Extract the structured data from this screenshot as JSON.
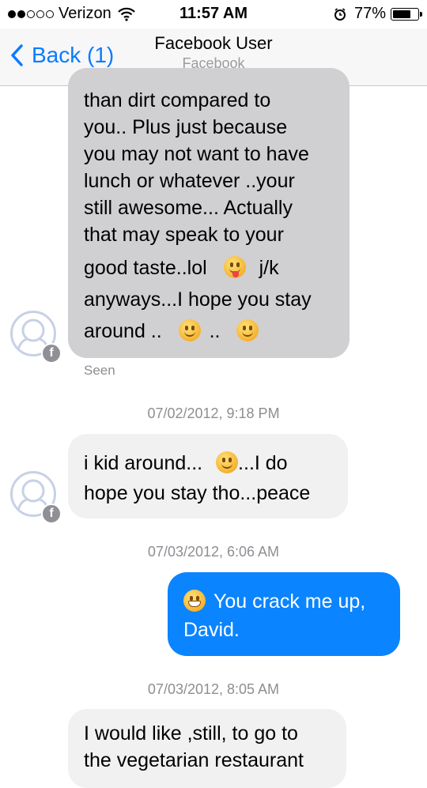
{
  "status_bar": {
    "carrier": "Verizon",
    "time": "11:57 AM",
    "battery": "77%",
    "battery_level": 0.77,
    "signal_bars": 2,
    "signal_total": 5
  },
  "nav": {
    "back_label": "Back (1)",
    "title": "Facebook User",
    "subtitle": "Facebook"
  },
  "messages": {
    "m1": {
      "lines": [
        "than dirt compared to",
        "you..  Plus just because",
        "you may not want to have",
        "lunch or whatever ..your",
        "still awesome... Actually",
        "that may speak to your"
      ],
      "line7_a": "good taste..lol",
      "line7_b": "j/k",
      "line8": "anyways...I hope you stay",
      "line9_a": "around ..",
      "line9_b": ".."
    },
    "seen": "Seen",
    "ts1": "07/02/2012, 9:18 PM",
    "m2": {
      "line1_a": "i kid around...",
      "line1_b": "...I do",
      "line2": "hope you stay tho...peace"
    },
    "ts2": "07/03/2012, 6:06 AM",
    "m3": {
      "line1": "You crack me up,",
      "line2": "David."
    },
    "ts3": "07/03/2012, 8:05 AM",
    "m4": {
      "line1": "I would like ,still, to go to",
      "line2": "the  vegetarian restaurant"
    }
  },
  "icons": {
    "back": "chevron-left-icon",
    "wifi": "wifi-icon",
    "alarm": "alarm-icon",
    "badge": "facebook-badge-icon",
    "badge_glyph": "f"
  },
  "colors": {
    "accent": "#0a7bff",
    "outgoing_bubble": "#0a84ff",
    "incoming_bubble_dark": "#d0d0d3",
    "incoming_bubble_light": "#f1f1f1"
  }
}
